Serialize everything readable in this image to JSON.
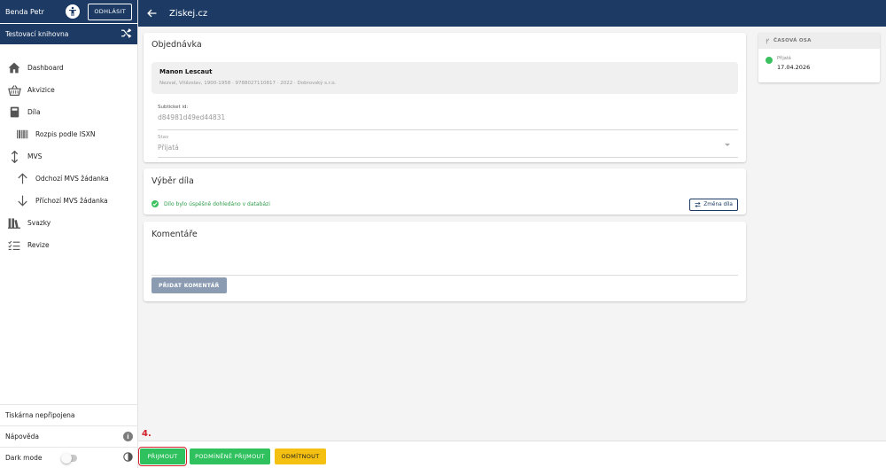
{
  "sidebar": {
    "user": {
      "name": "Benda Petr",
      "logout_label": "ODHLÁSIT"
    },
    "library": {
      "name": "Testovací knihovna"
    },
    "nav": [
      {
        "label": "Dashboard",
        "icon": "home-icon"
      },
      {
        "label": "Akvizice",
        "icon": "basket-icon"
      },
      {
        "label": "Díla",
        "icon": "book-icon"
      },
      {
        "label": "Rozpis podle ISXN",
        "icon": "barcode-icon"
      },
      {
        "label": "MVS",
        "icon": "up-down-arrow-icon"
      },
      {
        "label": "Odchozí MVS žádanka",
        "icon": "arrow-up-icon"
      },
      {
        "label": "Příchozí MVS žádanka",
        "icon": "arrow-down-icon"
      },
      {
        "label": "Svazky",
        "icon": "library-icon"
      },
      {
        "label": "Revize",
        "icon": "checklist-icon"
      }
    ],
    "printer_status": "Tiskárna nepřipojena",
    "help_label": "Nápověda",
    "dark_mode_label": "Dark mode",
    "dark_mode_on": false
  },
  "topbar": {
    "title": "Ziskej.cz"
  },
  "order": {
    "title": "Objednávka",
    "book_title": "Manon Lescaut",
    "book_desc": "Nezval, Vítězslav, 1900-1958 · 9788027110817 · 2022 · Dobrovský s.r.o.",
    "subticket_label": "Subticket id:",
    "subticket_value": "d84981d49ed44831",
    "status_label": "Stav",
    "status_value": "Přijatá"
  },
  "selection": {
    "title": "Výběr díla",
    "found_text": "Dílo bylo úspěšně dohledáno v databázi",
    "change_label": "Změna díla"
  },
  "comments": {
    "title": "Komentáře",
    "add_label": "PŘIDAT KOMENTÁŘ"
  },
  "timeline": {
    "title": "ČASOVÁ OSA",
    "event_label": "Přijatá",
    "event_date": "17.04.2026"
  },
  "actions": {
    "step_label": "4.",
    "accept_label": "PŘIJMOUT",
    "conditional_label": "PODMÍNĚNĚ PŘIJMOUT",
    "reject_label": "ODMÍTNOUT"
  },
  "colors": {
    "primary": "#1c3a63",
    "success": "#2ec15e",
    "warning": "#f4c011",
    "highlight": "#d0212b"
  }
}
